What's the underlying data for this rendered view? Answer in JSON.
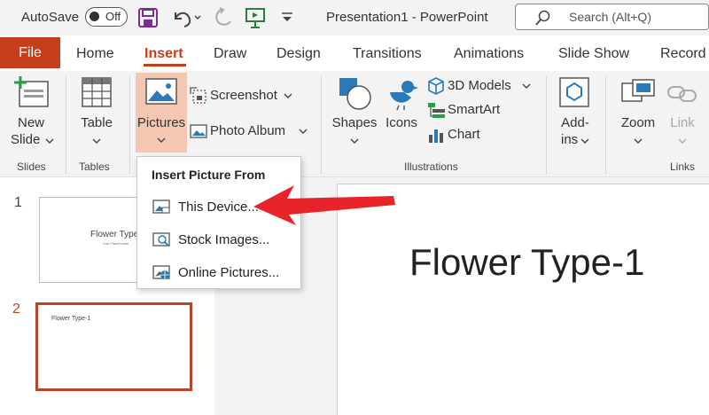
{
  "titlebar": {
    "autosave_label": "AutoSave",
    "autosave_state": "Off",
    "doc_title": "Presentation1  -  PowerPoint",
    "search_placeholder": "Search (Alt+Q)"
  },
  "tabs": {
    "file": "File",
    "items": [
      "Home",
      "Insert",
      "Draw",
      "Design",
      "Transitions",
      "Animations",
      "Slide Show",
      "Record"
    ],
    "active": "Insert"
  },
  "ribbon": {
    "new_slide": [
      "New",
      "Slide"
    ],
    "table": "Table",
    "pictures": "Pictures",
    "screenshot": "Screenshot",
    "photo_album": "Photo Album",
    "shapes": "Shapes",
    "icons": "Icons",
    "models_3d": "3D Models",
    "smartart": "SmartArt",
    "chart": "Chart",
    "addins": [
      "Add-",
      "ins"
    ],
    "zoom": "Zoom",
    "link": "Link",
    "groups": {
      "slides": "Slides",
      "tables": "Tables",
      "illustrations": "Illustrations",
      "links": "Links"
    }
  },
  "dropdown": {
    "heading": "Insert Picture From",
    "items": [
      "This Device...",
      "Stock Images...",
      "Online Pictures..."
    ]
  },
  "slides": {
    "numbers": [
      "1",
      "2"
    ],
    "thumb1_title": "Flower Type",
    "thumb1_sub": "Sub Placeholder",
    "thumb2_title": "Flower Type-1"
  },
  "editor": {
    "slide_title": "Flower Type-1"
  },
  "colors": {
    "accent": "#c43e1c",
    "arrow": "#e8232a",
    "selected_thumb_border": "#b7472a"
  }
}
